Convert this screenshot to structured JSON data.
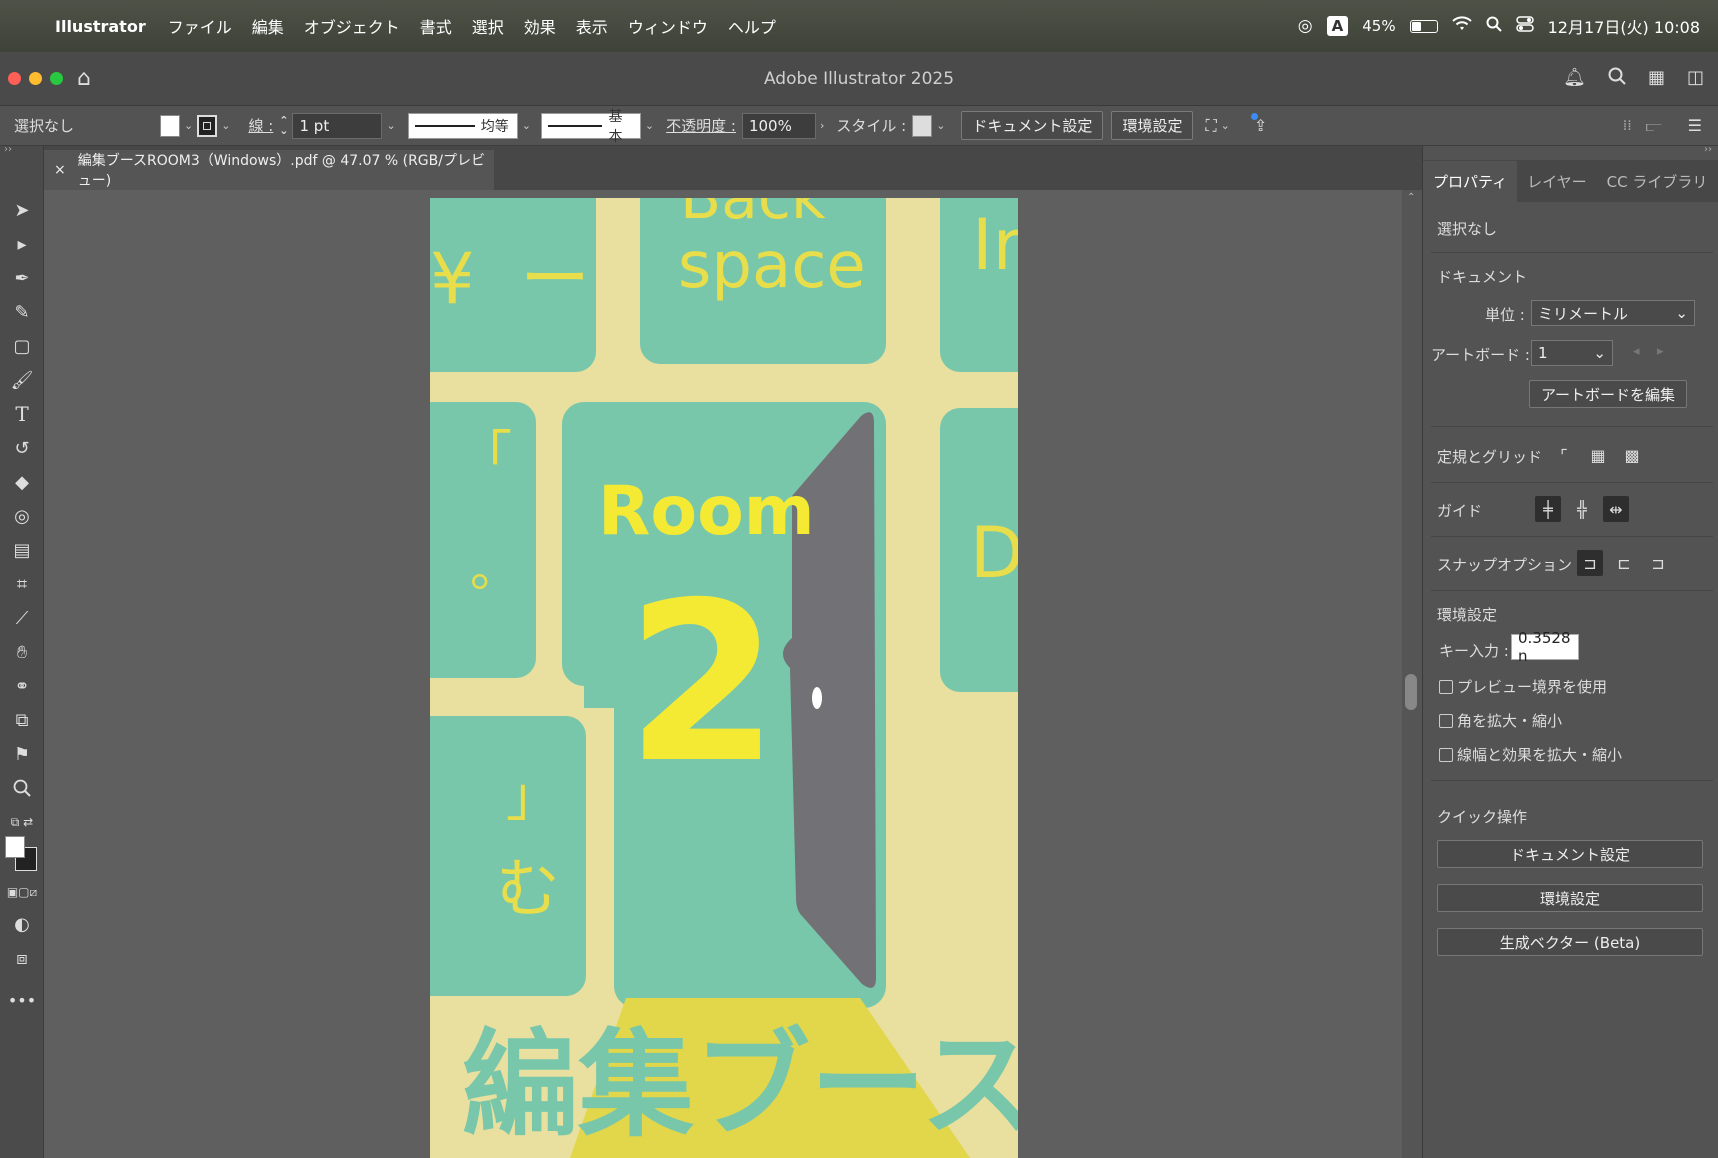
{
  "menubar": {
    "app_name": "Illustrator",
    "items": [
      "ファイル",
      "編集",
      "オブジェクト",
      "書式",
      "選択",
      "効果",
      "表示",
      "ウィンドウ",
      "ヘルプ"
    ],
    "input_mode": "A",
    "battery": "45%",
    "battery_level_percent": 45,
    "datetime": "12月17日(火) 10:08"
  },
  "window": {
    "title": "Adobe Illustrator 2025"
  },
  "control_bar": {
    "selection": "選択なし",
    "stroke_label": "線 :",
    "stroke_weight": "1 pt",
    "profile_label": "均等",
    "brush_label": "基本",
    "opacity_label": "不透明度 :",
    "opacity_value": "100%",
    "style_label": "スタイル :",
    "doc_settings_button": "ドキュメント設定",
    "preferences_button": "環境設定"
  },
  "document_tab": {
    "close": "×",
    "title": "編集ブースROOM3（Windows）.pdf @ 47.07 % (RGB/プレビュー)"
  },
  "artwork": {
    "key_backspace_top": "Back",
    "key_backspace_bottom": "space",
    "key_yen": "¥",
    "key_minus": "ー",
    "key_insert_partial": "Ir",
    "key_bracket_open": "「",
    "key_circle": "。",
    "key_bracket_close": "」",
    "key_mu": "む",
    "key_d_partial": "D",
    "room_label": "Room",
    "room_number": "2",
    "headline": "編集ブース",
    "colors": {
      "background": "#e9df9f",
      "key": "#79c7ab",
      "text_yellow": "#e8dd4a",
      "number_yellow": "#f4ea34",
      "door": "#727175",
      "headline": "#79c7ab",
      "light_beam": "#e2d64a"
    }
  },
  "panel": {
    "tabs": [
      "プロパティ",
      "レイヤー",
      "CC ライブラリ"
    ],
    "no_selection": "選択なし",
    "document_header": "ドキュメント",
    "unit_label": "単位 :",
    "unit_value": "ミリメートル",
    "artboard_label": "アートボード :",
    "artboard_value": "1",
    "edit_artboard_button": "アートボードを編集",
    "rulers_grids_label": "定規とグリッド",
    "guides_label": "ガイド",
    "snap_label": "スナップオプション",
    "prefs_header": "環境設定",
    "key_input_label": "キー入力 :",
    "key_input_value": "0.3528 n",
    "preview_bounds": "プレビュー境界を使用",
    "scale_corners": "角を拡大・縮小",
    "scale_strokes": "線幅と効果を拡大・縮小",
    "quick_actions_header": "クイック操作",
    "qa_doc_settings": "ドキュメント設定",
    "qa_preferences": "環境設定",
    "qa_generative_vector": "生成ベクター (Beta)"
  }
}
